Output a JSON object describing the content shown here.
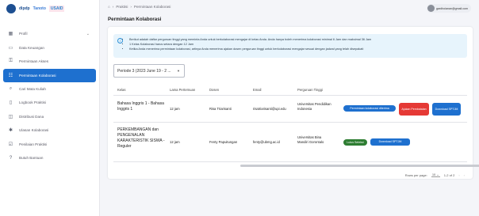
{
  "logos": {
    "a": "dipdp",
    "b": "Tanoto",
    "c": "USAID"
  },
  "sidebar": {
    "items": [
      {
        "label": "Profil",
        "icon": "grid-icon"
      },
      {
        "label": "Data Keuangan",
        "icon": "card-icon"
      },
      {
        "label": "Permintaan Akses",
        "icon": "key-icon"
      },
      {
        "label": "Permintaan Kolaborasi",
        "icon": "people-icon"
      },
      {
        "label": "Cari Mata Kuliah",
        "icon": "search-icon"
      },
      {
        "label": "Logbook Praktisi",
        "icon": "book-icon"
      },
      {
        "label": "Distribusi Dana",
        "icon": "money-icon"
      },
      {
        "label": "Ulasan Kolaborasi",
        "icon": "gear-icon"
      },
      {
        "label": "Penilaian Praktisi",
        "icon": "check-icon"
      },
      {
        "label": "Butuh Bantuan",
        "icon": "help-icon"
      }
    ]
  },
  "breadcrumb": {
    "home": "⌂",
    "a": "Praktisi",
    "b": "Permintaan Kolaborasi"
  },
  "page_title": "Permintaan Kolaborasi",
  "user": {
    "email": "gardhoianan@gmail.com"
  },
  "info": [
    "Berikut adalah daftar perguruan tinggi yang meminta Anda untuk berkolaborasi mengajar di kelas Anda. Anda hanya boleh menerima kolaborasi minimal 6 Jam dan maksimal 36 Jam",
    "1 Kelas Kolaborasi harus setara dengan 12 Jam",
    "Ketika Anda menerima permintaan kolaborasi, artinya Anda menerima ajakan dosen perguruan tinggi untuk berkolaborasi mengajar sesuai dengan jadwal yang telah disepakati"
  ],
  "period_select": "Periode 3 (2023 June 19 - 2 ...",
  "table": {
    "headers": [
      "Kelas",
      "Lama Pertemuan",
      "Dosen",
      "Email",
      "Perguruan Tinggi",
      ""
    ],
    "rows": [
      {
        "kelas": "Bahasa Inggris 1 - Bahasa Inggris 1",
        "lama": "12 jam",
        "dosen": "Risa Triarisanti",
        "email": "risatriarisanti@upi.edu",
        "pt": "Universitas Pendidikan Indonesia",
        "status": "Permintaan kolaborasi diterima",
        "btn_a": "Ajukan Pembatalan",
        "btn_b": "Download SPTJM"
      },
      {
        "kelas": "PERKEMBANGAN dan PENGENALAN KARAKTERISTIK SISWA - Reguler",
        "lama": "12 jam",
        "dosen": "Fenty Papuitungan",
        "email": "fenty@ubmg.ac.id",
        "pt": "Universitas Bina Mandiri Gorontalo",
        "status": "Lulus Seleksi",
        "btn_b": "Download SPTJM"
      }
    ]
  },
  "pagination": {
    "rows_label": "Rows per page:",
    "rows_value": "10",
    "range": "1-2 of 2",
    "prev": "‹",
    "next": "›"
  },
  "colors": {
    "primary": "#1e70cf",
    "danger": "#e53935",
    "success": "#2e7d32",
    "info_bg": "#e7f4fc"
  }
}
